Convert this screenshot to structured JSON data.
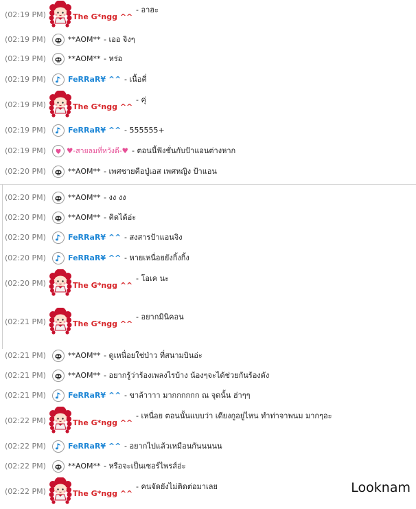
{
  "messages": [
    {
      "time": "(02:19 PM)",
      "user": "The G*ngg ^^",
      "text": "- อาฮะ",
      "kind": "g",
      "tall": true
    },
    {
      "time": "(02:19 PM)",
      "user": "**AOM**",
      "text": "- เออ จิงๆ",
      "kind": "aom"
    },
    {
      "time": "(02:19 PM)",
      "user": "**AOM**",
      "text": "- หร่อ",
      "kind": "aom"
    },
    {
      "time": "(02:19 PM)",
      "user": "FeRRaR¥ ^^",
      "text": "- เนื้อคี่",
      "kind": "fer"
    },
    {
      "time": "(02:19 PM)",
      "user": "The G*ngg ^^",
      "text": "- คุ่",
      "kind": "g",
      "tall": true
    },
    {
      "time": "(02:19 PM)",
      "user": "FeRRaR¥ ^^",
      "text": "- 555555+",
      "kind": "fer"
    },
    {
      "time": "(02:19 PM)",
      "user": "♥-สายลมที่หวังดี-♥",
      "text": "- ตอนนี้ฟังชั่นกับป้าแอนต่างหาก",
      "kind": "pink"
    },
    {
      "time": "(02:20 PM)",
      "user": "**AOM**",
      "text": "- เพศชายคือปู่เอส เพศหญิง ป้าแอน",
      "kind": "aom"
    },
    {
      "time": "(02:20 PM)",
      "user": "**AOM**",
      "text": "- งง งง",
      "kind": "aom"
    },
    {
      "time": "(02:20 PM)",
      "user": "**AOM**",
      "text": "- คิดได้อ่ะ",
      "kind": "aom"
    },
    {
      "time": "(02:20 PM)",
      "user": "FeRRaR¥ ^^",
      "text": "- สงสารป้าแอนจิง",
      "kind": "fer"
    },
    {
      "time": "(02:20 PM)",
      "user": "FeRRaR¥ ^^",
      "text": "- หายเหนื่อยยังกิ้งกิ้ง",
      "kind": "fer"
    },
    {
      "time": "(02:20 PM)",
      "user": "The G*ngg ^^",
      "text": "- โอเค นะ",
      "kind": "g",
      "tall": true
    },
    {
      "time": "(02:21 PM)",
      "user": "The G*ngg ^^",
      "text": "- อยากมินิคอน",
      "kind": "g",
      "tall": true
    },
    {
      "time": "(02:21 PM)",
      "user": "**AOM**",
      "text": "- ดูเหนื่อยใช่ป่าว ที่สนามบินอ่ะ",
      "kind": "aom"
    },
    {
      "time": "(02:21 PM)",
      "user": "**AOM**",
      "text": "- อยากรู้ว่าร้องเพลงไรบ้าง น้องๆจะได้ช่วยกันร้องดัง",
      "kind": "aom"
    },
    {
      "time": "(02:21 PM)",
      "user": "FeRRaR¥ ^^",
      "text": "- ขาล้าาาา มากกกกกก ณ จุดนั้น ฮ่าๆๆ",
      "kind": "fer"
    },
    {
      "time": "(02:22 PM)",
      "user": "The G*ngg ^^",
      "text": "- เหนื่อย ตอนนั้นแบบว่า เดียงกูอยู่ไหน ทำท่าจาพนม มากๆอะ",
      "kind": "g",
      "tall": true
    },
    {
      "time": "(02:22 PM)",
      "user": "FeRRaR¥ ^^",
      "text": "- อยากไปแล้วเหมือนกันนนนน",
      "kind": "fer"
    },
    {
      "time": "(02:22 PM)",
      "user": "**AOM**",
      "text": "- หรือจะเป็นเซอร์ไพรส์อ่ะ",
      "kind": "aom"
    },
    {
      "time": "(02:22 PM)",
      "user": "The G*ngg ^^",
      "text": "- คนจัดยังไม่ติดต่อมาเลย",
      "kind": "g",
      "tall": true
    }
  ],
  "watermark": "Looknam",
  "colors": {
    "gname": "#d7262a",
    "fername": "#1f87d6",
    "pinkname": "#e64f96",
    "timestamp": "#7a7a7a"
  },
  "icons": {
    "aom": "skull-avatar-icon",
    "fer": "music-note-avatar-icon",
    "pink": "heart-avatar-icon",
    "g": "red-hair-girl-avatar-icon"
  }
}
